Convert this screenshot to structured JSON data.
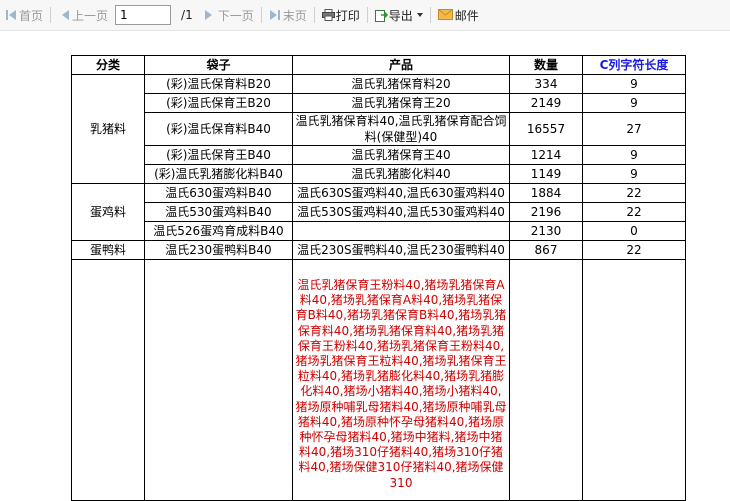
{
  "toolbar": {
    "first": "首页",
    "prev": "上一页",
    "page_value": "1",
    "page_total": "/1",
    "next": "下一页",
    "last": "末页",
    "print": "打印",
    "export": "导出",
    "mail": "邮件"
  },
  "table": {
    "headers": [
      "分类",
      "袋子",
      "产品",
      "数量",
      "C列字符长度"
    ],
    "groups": {
      "g1": "乳猪料",
      "g2": "蛋鸡料",
      "g3": "蛋鸭料"
    },
    "rows": [
      {
        "bag": "(彩)温氏保育料B20",
        "product": "温氏乳猪保育料20",
        "qty": "334",
        "len": "9"
      },
      {
        "bag": "(彩)温氏保育王B20",
        "product": "温氏乳猪保育王20",
        "qty": "2149",
        "len": "9"
      },
      {
        "bag": "(彩)温氏保育料B40",
        "product": "温氏乳猪保育料40,温氏乳猪保育配合饲料(保健型)40",
        "qty": "16557",
        "len": "27"
      },
      {
        "bag": "(彩)温氏保育王B40",
        "product": "温氏乳猪保育王40",
        "qty": "1214",
        "len": "9"
      },
      {
        "bag": "(彩)温氏乳猪膨化料B40",
        "product": "温氏乳猪膨化料40",
        "qty": "1149",
        "len": "9"
      },
      {
        "bag": "温氏630蛋鸡料B40",
        "product": "温氏630S蛋鸡料40,温氏630蛋鸡料40",
        "qty": "1884",
        "len": "22"
      },
      {
        "bag": "温氏530蛋鸡料B40",
        "product": "温氏530S蛋鸡料40,温氏530蛋鸡料40",
        "qty": "2196",
        "len": "22"
      },
      {
        "bag": "温氏526蛋鸡育成料B40",
        "product": "",
        "qty": "2130",
        "len": "0"
      },
      {
        "bag": "温氏230蛋鸭料B40",
        "product": "温氏230S蛋鸭料40,温氏230蛋鸭料40",
        "qty": "867",
        "len": "22"
      }
    ],
    "last_row_product": "温氏乳猪保育王粉料40,猪场乳猪保育A料40,猪场乳猪保育A料40,猪场乳猪保育B料40,猪场乳猪保育B料40,猪场乳猪保育料40,猪场乳猪保育料40,猪场乳猪保育王粉料40,猪场乳猪保育王粉料40,猪场乳猪保育王粒料40,猪场乳猪保育王粒料40,猪场乳猪膨化料40,猪场乳猪膨化料40,猪场小猪料40,猪场小猪料40,猪场原种哺乳母猪料40,猪场原种哺乳母猪料40,猪场原种怀孕母猪料40,猪场原种怀孕母猪料40,猪场中猪料,猪场中猪料40,猪场310仔猪料40,猪场310仔猪料40,猪场保健310仔猪料40,猪场保健310"
  }
}
